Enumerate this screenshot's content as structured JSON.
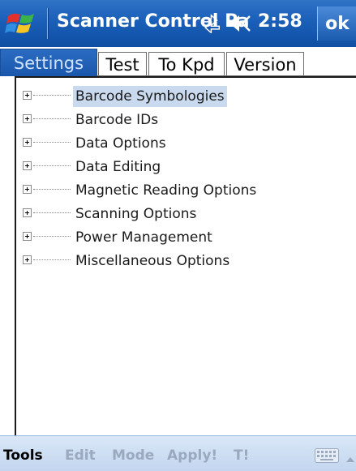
{
  "titlebar": {
    "start_icon": "windows-flag-icon",
    "title": "Scanner Control Pa",
    "connectivity_icon": "connectivity-icon",
    "volume_icon": "volume-icon",
    "time": "2:58",
    "ok_label": "ok"
  },
  "tabs": [
    {
      "label": "Settings",
      "active": true
    },
    {
      "label": "Test",
      "active": false
    },
    {
      "label": "To Kpd",
      "active": false
    },
    {
      "label": "Version",
      "active": false
    }
  ],
  "tree": {
    "items": [
      {
        "label": "Barcode Symbologies",
        "selected": true
      },
      {
        "label": "Barcode IDs",
        "selected": false
      },
      {
        "label": "Data Options",
        "selected": false
      },
      {
        "label": "Data Editing",
        "selected": false
      },
      {
        "label": "Magnetic Reading Options",
        "selected": false
      },
      {
        "label": "Scanning Options",
        "selected": false
      },
      {
        "label": "Power Management",
        "selected": false
      },
      {
        "label": "Miscellaneous Options",
        "selected": false
      }
    ]
  },
  "menubar": {
    "tools": "Tools",
    "edit": "Edit",
    "mode": "Mode",
    "apply": "Apply!",
    "t": "T!",
    "keyboard_icon": "keyboard-icon",
    "arrow_icon": "chevron-up-icon"
  },
  "colors": {
    "titlebar": "#1a5fb8",
    "active_tab": "#1a57ab",
    "selection": "#c9d9ee",
    "menubar": "#c3d6ef",
    "disabled_menu_text": "#9aa9bd"
  }
}
